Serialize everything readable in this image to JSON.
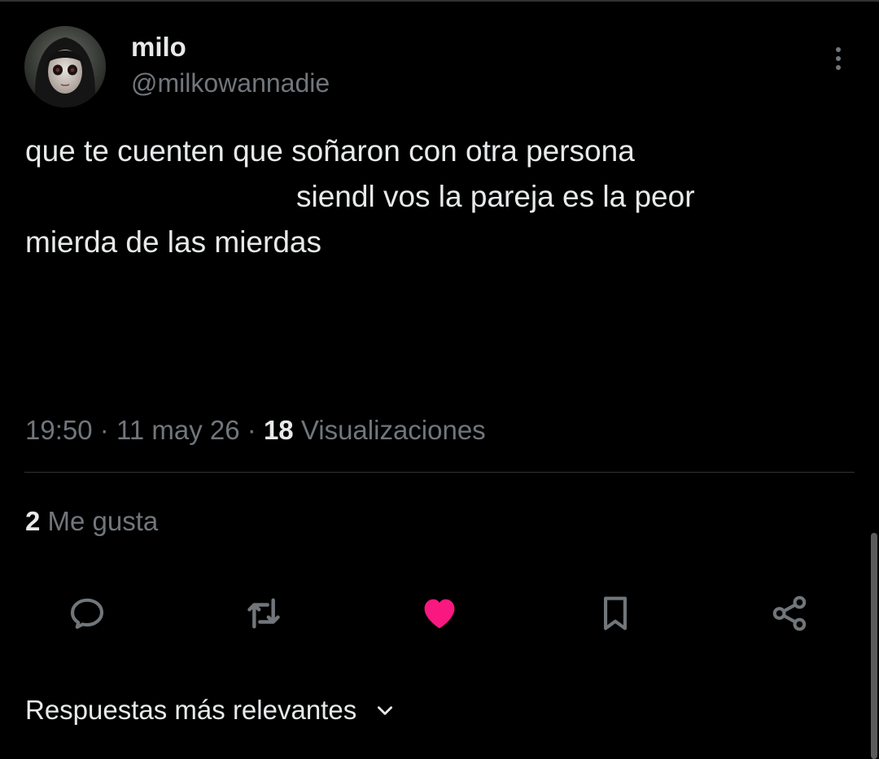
{
  "tweet": {
    "author": {
      "display_name": "milo",
      "handle": "@milkowannadie",
      "avatar_icon": "avatar"
    },
    "text_lines": [
      "que te cuenten que soñaron con otra persona",
      "siendl vos la pareja es la peor",
      "mierda de las mierdas"
    ],
    "time": "19:50",
    "date": "11 may 26",
    "separator": "·",
    "views_count": "18",
    "views_label": "Visualizaciones",
    "likes_count": "2",
    "likes_label": "Me gusta"
  },
  "actions": {
    "reply_icon": "reply-icon",
    "retweet_icon": "retweet-icon",
    "like_icon": "heart-icon",
    "like_active": true,
    "bookmark_icon": "bookmark-icon",
    "share_icon": "share-icon"
  },
  "replies": {
    "sort_label": "Respuestas más relevantes"
  },
  "colors": {
    "background": "#000000",
    "text_primary": "#e7e9ea",
    "text_secondary": "#71767b",
    "like_active": "#f91880",
    "divider": "#2f3336"
  }
}
